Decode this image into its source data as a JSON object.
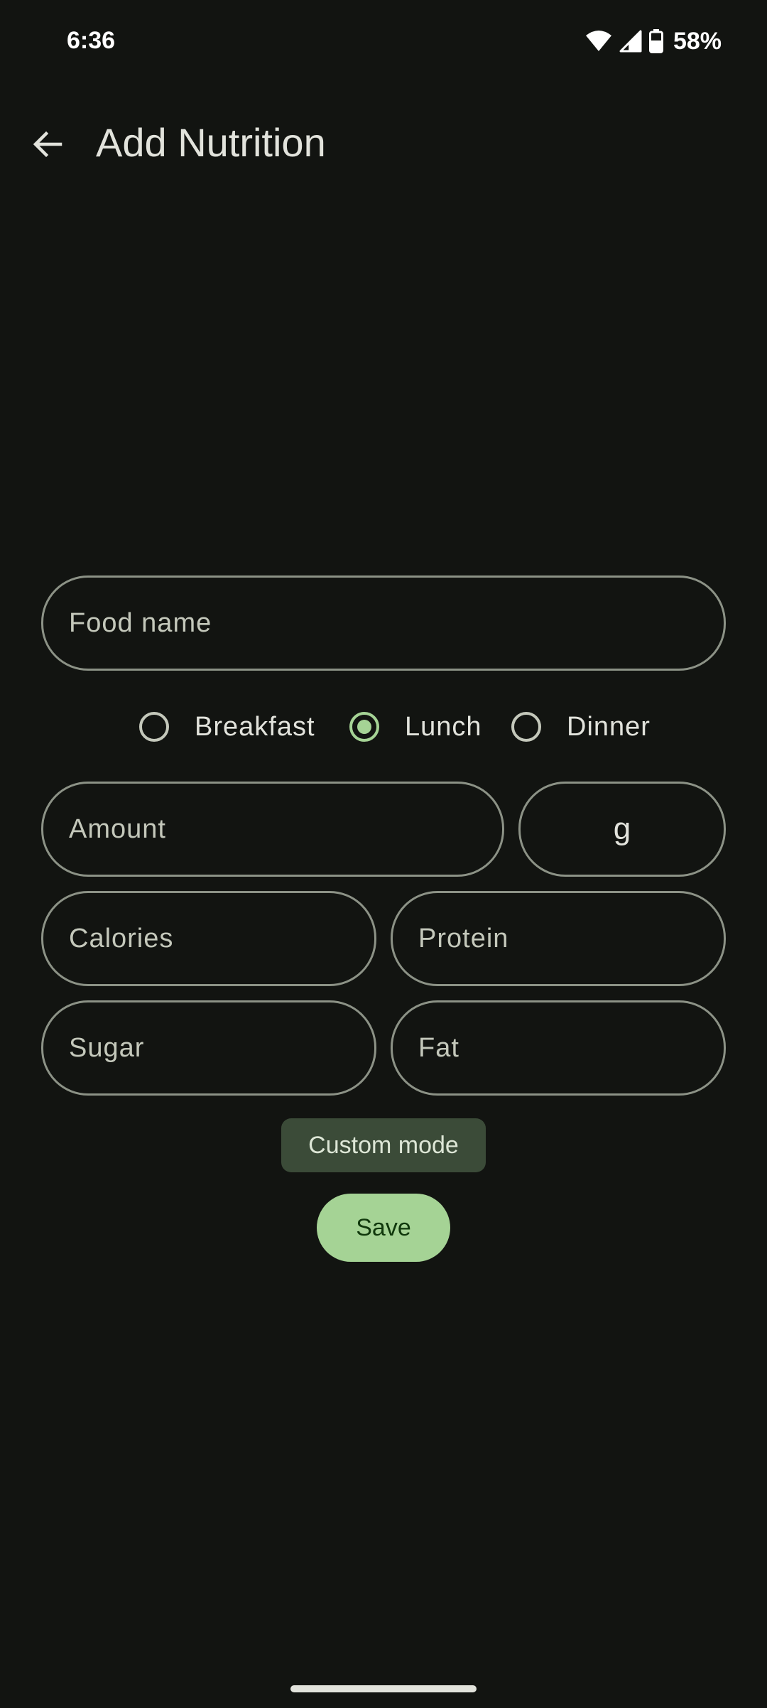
{
  "status_bar": {
    "time": "6:36",
    "battery_percent": "58%",
    "icons": [
      "wifi-icon",
      "cell-signal-icon",
      "battery-icon"
    ]
  },
  "app_bar": {
    "back_icon": "arrow-left-icon",
    "title": "Add Nutrition"
  },
  "form": {
    "food_name_placeholder": "Food name",
    "food_name_value": "",
    "meal_options": [
      {
        "label": "Breakfast",
        "checked": false
      },
      {
        "label": "Lunch",
        "checked": true
      },
      {
        "label": "Dinner",
        "checked": false
      }
    ],
    "amount_placeholder": "Amount",
    "unit_value": "g",
    "calories_placeholder": "Calories",
    "protein_placeholder": "Protein",
    "sugar_placeholder": "Sugar",
    "fat_placeholder": "Fat"
  },
  "actions": {
    "custom_mode_label": "Custom mode",
    "save_label": "Save"
  },
  "colors": {
    "background": "#121411",
    "accent": "#a5d395",
    "field_outline": "#8c9286",
    "custom_mode_bg": "#3b4b38"
  }
}
